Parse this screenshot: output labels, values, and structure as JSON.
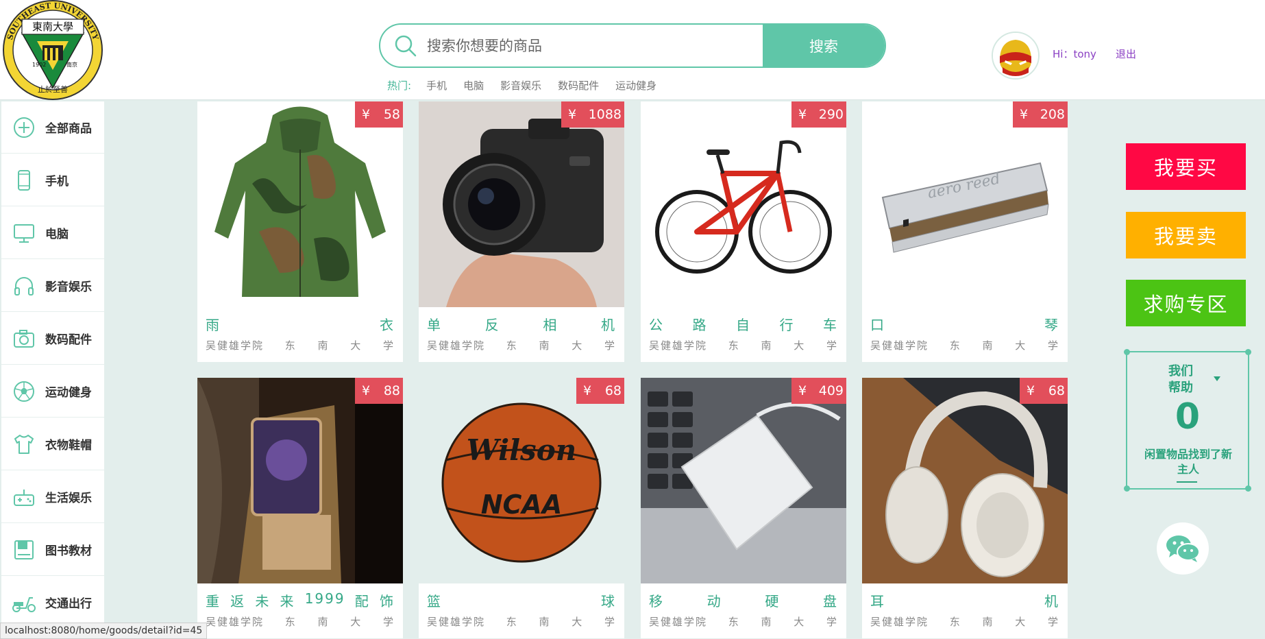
{
  "header": {
    "logo": {
      "university_name": "SOUTHEAST UNIVERSITY",
      "chinese_name": "東南大學",
      "year": "1902",
      "city": "南京",
      "motto": "止於至善"
    },
    "search": {
      "placeholder": "搜索你想要的商品",
      "button_label": "搜索"
    },
    "hot": {
      "label": "热门:",
      "items": [
        "手机",
        "电脑",
        "影音娱乐",
        "数码配件",
        "运动健身"
      ]
    },
    "user": {
      "greeting": "Hi：tony",
      "logout_label": "退出"
    }
  },
  "sidebar": {
    "items": [
      {
        "label": "全部商品",
        "icon": "plus-circle-icon"
      },
      {
        "label": "手机",
        "icon": "phone-icon"
      },
      {
        "label": "电脑",
        "icon": "monitor-icon"
      },
      {
        "label": "影音娱乐",
        "icon": "headphones-icon"
      },
      {
        "label": "数码配件",
        "icon": "camera-icon"
      },
      {
        "label": "运动健身",
        "icon": "soccer-ball-icon"
      },
      {
        "label": "衣物鞋帽",
        "icon": "shirt-icon"
      },
      {
        "label": "生活娱乐",
        "icon": "gamepad-icon"
      },
      {
        "label": "图书教材",
        "icon": "book-icon"
      },
      {
        "label": "交通出行",
        "icon": "scooter-icon"
      }
    ]
  },
  "products": [
    {
      "price": "58",
      "name": [
        "雨",
        "衣"
      ],
      "location": [
        "吴健雄学院",
        "东",
        "南",
        "大",
        "学"
      ],
      "image": "camo-raincoat"
    },
    {
      "price": "1088",
      "name": [
        "单",
        "反",
        "相",
        "机"
      ],
      "location": [
        "吴健雄学院",
        "东",
        "南",
        "大",
        "学"
      ],
      "image": "dslr-camera"
    },
    {
      "price": "290",
      "name": [
        "公",
        "路",
        "自",
        "行",
        "车"
      ],
      "location": [
        "吴健雄学院",
        "东",
        "南",
        "大",
        "学"
      ],
      "image": "road-bike"
    },
    {
      "price": "208",
      "name": [
        "口",
        "琴"
      ],
      "location": [
        "吴健雄学院",
        "东",
        "南",
        "大",
        "学"
      ],
      "image": "harmonica"
    },
    {
      "price": "88",
      "name": [
        "重",
        "返",
        "未",
        "来",
        "1999",
        "配",
        "饰"
      ],
      "location": [
        "吴健雄学院",
        "东",
        "南",
        "大",
        "学"
      ],
      "image": "accessory"
    },
    {
      "price": "68",
      "name": [
        "篮",
        "球"
      ],
      "location": [
        "吴健雄学院",
        "东",
        "南",
        "大",
        "学"
      ],
      "image": "basketball"
    },
    {
      "price": "409",
      "name": [
        "移",
        "动",
        "硬",
        "盘"
      ],
      "location": [
        "吴健雄学院",
        "东",
        "南",
        "大",
        "学"
      ],
      "image": "hard-drive"
    },
    {
      "price": "68",
      "name": [
        "耳",
        "机"
      ],
      "location": [
        "吴健雄学院",
        "东",
        "南",
        "大",
        "学"
      ],
      "image": "headphones"
    }
  ],
  "currency_symbol": "¥",
  "side_buttons": [
    {
      "label": "我要买",
      "color": "#ff0844"
    },
    {
      "label": "我要卖",
      "color": "#ffb000"
    },
    {
      "label": "求购专区",
      "color": "#4cc414"
    }
  ],
  "help_panel": {
    "title_line1": "我们",
    "title_line2": "帮助",
    "count": "0",
    "text": "闲置物品找到了新主人"
  },
  "status_bar": {
    "url": "localhost:8080/home/goods/detail?id=45"
  },
  "colors": {
    "accent": "#5fc6a8",
    "price_tag": "#e24f5b",
    "text_green": "#35a887"
  }
}
